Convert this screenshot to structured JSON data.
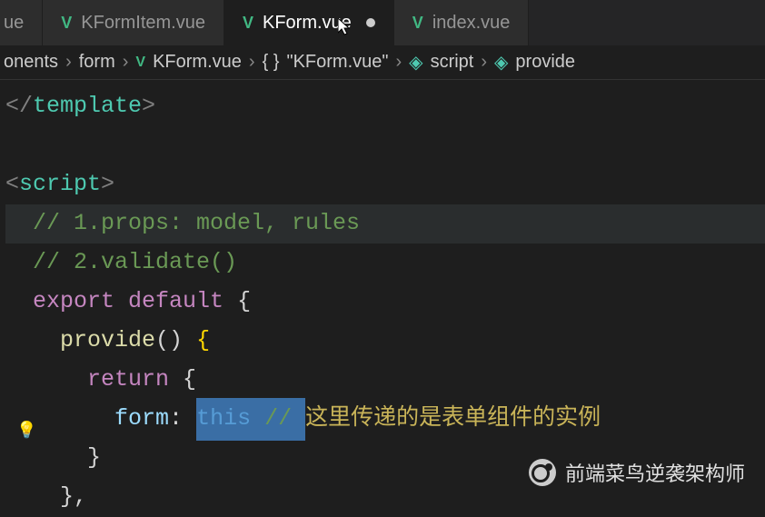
{
  "tabs": [
    {
      "label": "ue",
      "active": false,
      "dirty": false
    },
    {
      "label": "KFormItem.vue",
      "active": false,
      "dirty": false
    },
    {
      "label": "KForm.vue",
      "active": true,
      "dirty": true
    },
    {
      "label": "index.vue",
      "active": false,
      "dirty": false
    }
  ],
  "breadcrumb": {
    "seg0": "onents",
    "seg1": "form",
    "seg2": "KForm.vue",
    "seg3": "\"KForm.vue\"",
    "seg4": "script",
    "seg5": "provide"
  },
  "code": {
    "l1_open": "</",
    "l1_tag": "template",
    "l1_close": ">",
    "l2_open": "<",
    "l2_tag": "script",
    "l2_close": ">",
    "l3_comment": "  // 1.props: model, rules",
    "l4_comment": "  // 2.validate()",
    "l5_export": "  export",
    "l5_default": " default",
    "l5_brace": " {",
    "l6_indent": "    ",
    "l6_fn": "provide",
    "l6_paren": "() ",
    "l6_brace": "{",
    "l7_indent": "      ",
    "l7_return": "return",
    "l7_brace": " {",
    "l8_indent": "        ",
    "l8_prop": "form",
    "l8_colon": ": ",
    "l8_this": "this",
    "l8_slash": " // ",
    "l8_cn": "这里传递的是表单组件的实例",
    "l9": "      }",
    "l10": "    },"
  },
  "watermark": "前端菜鸟逆袭架构师"
}
